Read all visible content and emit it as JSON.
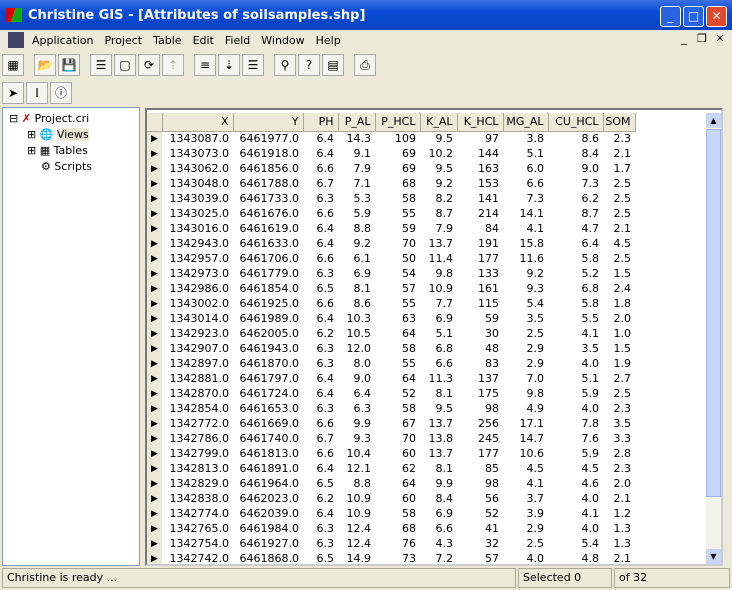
{
  "window": {
    "title": "Christine GIS - [Attributes of soilsamples.shp]",
    "minimize": "_",
    "maximize": "□",
    "close": "✕"
  },
  "menu": [
    "Application",
    "Project",
    "Table",
    "Edit",
    "Field",
    "Window",
    "Help"
  ],
  "tree": {
    "root": "Project.cri",
    "items": [
      "Views",
      "Tables",
      "Scripts"
    ]
  },
  "table": {
    "columns": [
      "X",
      "Y",
      "PH",
      "P_AL",
      "P_HCL",
      "K_AL",
      "K_HCL",
      "MG_AL",
      "CU_HCL",
      "SOM"
    ],
    "rows": [
      [
        "1343087.0",
        "6461977.0",
        "6.4",
        "14.3",
        "109",
        "9.5",
        "97",
        "3.8",
        "8.6",
        "2.3"
      ],
      [
        "1343073.0",
        "6461918.0",
        "6.4",
        "9.1",
        "69",
        "10.2",
        "144",
        "5.1",
        "8.4",
        "2.1"
      ],
      [
        "1343062.0",
        "6461856.0",
        "6.6",
        "7.9",
        "69",
        "9.5",
        "163",
        "6.0",
        "9.0",
        "1.7"
      ],
      [
        "1343048.0",
        "6461788.0",
        "6.7",
        "7.1",
        "68",
        "9.2",
        "153",
        "6.6",
        "7.3",
        "2.5"
      ],
      [
        "1343039.0",
        "6461733.0",
        "6.3",
        "5.3",
        "58",
        "8.2",
        "141",
        "7.3",
        "6.2",
        "2.5"
      ],
      [
        "1343025.0",
        "6461676.0",
        "6.6",
        "5.9",
        "55",
        "8.7",
        "214",
        "14.1",
        "8.7",
        "2.5"
      ],
      [
        "1343016.0",
        "6461619.0",
        "6.4",
        "8.8",
        "59",
        "7.9",
        "84",
        "4.1",
        "4.7",
        "2.1"
      ],
      [
        "1342943.0",
        "6461633.0",
        "6.4",
        "9.2",
        "70",
        "13.7",
        "191",
        "15.8",
        "6.4",
        "4.5"
      ],
      [
        "1342957.0",
        "6461706.0",
        "6.6",
        "6.1",
        "50",
        "11.4",
        "177",
        "11.6",
        "5.8",
        "2.5"
      ],
      [
        "1342973.0",
        "6461779.0",
        "6.3",
        "6.9",
        "54",
        "9.8",
        "133",
        "9.2",
        "5.2",
        "1.5"
      ],
      [
        "1342986.0",
        "6461854.0",
        "6.5",
        "8.1",
        "57",
        "10.9",
        "161",
        "9.3",
        "6.8",
        "2.4"
      ],
      [
        "1343002.0",
        "6461925.0",
        "6.6",
        "8.6",
        "55",
        "7.7",
        "115",
        "5.4",
        "5.8",
        "1.8"
      ],
      [
        "1343014.0",
        "6461989.0",
        "6.4",
        "10.3",
        "63",
        "6.9",
        "59",
        "3.5",
        "5.5",
        "2.0"
      ],
      [
        "1342923.0",
        "6462005.0",
        "6.2",
        "10.5",
        "64",
        "5.1",
        "30",
        "2.5",
        "4.1",
        "1.0"
      ],
      [
        "1342907.0",
        "6461943.0",
        "6.3",
        "12.0",
        "58",
        "6.8",
        "48",
        "2.9",
        "3.5",
        "1.5"
      ],
      [
        "1342897.0",
        "6461870.0",
        "6.3",
        "8.0",
        "55",
        "6.6",
        "83",
        "2.9",
        "4.0",
        "1.9"
      ],
      [
        "1342881.0",
        "6461797.0",
        "6.4",
        "9.0",
        "64",
        "11.3",
        "137",
        "7.0",
        "5.1",
        "2.7"
      ],
      [
        "1342870.0",
        "6461724.0",
        "6.4",
        "6.4",
        "52",
        "8.1",
        "175",
        "9.8",
        "5.9",
        "2.5"
      ],
      [
        "1342854.0",
        "6461653.0",
        "6.3",
        "6.3",
        "58",
        "9.5",
        "98",
        "4.9",
        "4.0",
        "2.3"
      ],
      [
        "1342772.0",
        "6461669.0",
        "6.6",
        "9.9",
        "67",
        "13.7",
        "256",
        "17.1",
        "7.8",
        "3.5"
      ],
      [
        "1342786.0",
        "6461740.0",
        "6.7",
        "9.3",
        "70",
        "13.8",
        "245",
        "14.7",
        "7.6",
        "3.3"
      ],
      [
        "1342799.0",
        "6461813.0",
        "6.6",
        "10.4",
        "60",
        "13.7",
        "177",
        "10.6",
        "5.9",
        "2.8"
      ],
      [
        "1342813.0",
        "6461891.0",
        "6.4",
        "12.1",
        "62",
        "8.1",
        "85",
        "4.5",
        "4.5",
        "2.3"
      ],
      [
        "1342829.0",
        "6461964.0",
        "6.5",
        "8.8",
        "64",
        "9.9",
        "98",
        "4.1",
        "4.6",
        "2.0"
      ],
      [
        "1342838.0",
        "6462023.0",
        "6.2",
        "10.9",
        "60",
        "8.4",
        "56",
        "3.7",
        "4.0",
        "2.1"
      ],
      [
        "1342774.0",
        "6462039.0",
        "6.4",
        "10.9",
        "58",
        "6.9",
        "52",
        "3.9",
        "4.1",
        "1.2"
      ],
      [
        "1342765.0",
        "6461984.0",
        "6.3",
        "12.4",
        "68",
        "6.6",
        "41",
        "2.9",
        "4.0",
        "1.3"
      ],
      [
        "1342754.0",
        "6461927.0",
        "6.3",
        "12.4",
        "76",
        "4.3",
        "32",
        "2.5",
        "5.4",
        "1.3"
      ],
      [
        "1342742.0",
        "6461868.0",
        "6.5",
        "14.9",
        "73",
        "7.2",
        "57",
        "4.0",
        "4.8",
        "2.1"
      ]
    ]
  },
  "status": {
    "message": "Christine is ready ...",
    "selected": "Selected 0",
    "total": "of 32"
  }
}
